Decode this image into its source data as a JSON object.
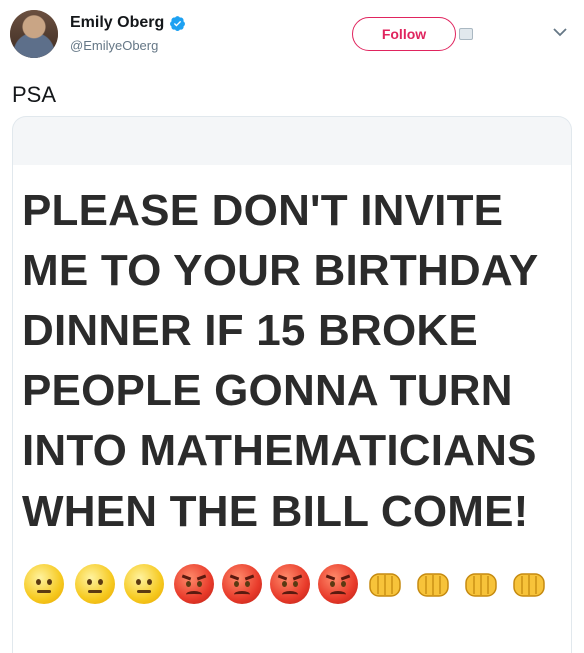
{
  "tweet": {
    "display_name": "Emily Oberg",
    "handle": "@EmilyeOberg",
    "follow_label": "Follow",
    "text": "PSA",
    "verified": true
  },
  "meme": {
    "lines": [
      "PLEASE DON'T INVITE",
      "ME TO YOUR BIRTHDAY",
      "DINNER IF 15 BROKE",
      "PEOPLE GONNA TURN",
      "INTO MATHEMATICIANS",
      "WHEN THE BILL COME!"
    ],
    "emojis": [
      "neutral-face",
      "neutral-face",
      "neutral-face",
      "pouting-face",
      "pouting-face",
      "pouting-face",
      "pouting-face",
      "oncoming-fist",
      "oncoming-fist",
      "oncoming-fist",
      "oncoming-fist"
    ]
  },
  "colors": {
    "accent": "#e0245e",
    "verified": "#1da1f2",
    "text": "#14171a",
    "secondary": "#657786"
  }
}
